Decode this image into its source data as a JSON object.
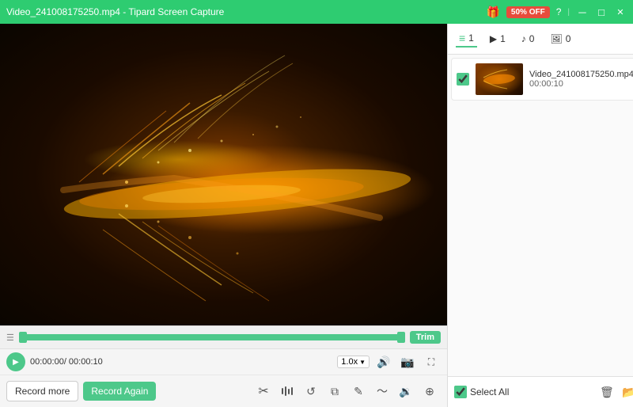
{
  "titleBar": {
    "title": "Video_241008175250.mp4  -  Tipard Screen Capture",
    "promoBadge": "50% OFF",
    "buttons": {
      "minimize": "－",
      "maximize": "□",
      "close": "✕"
    }
  },
  "tabs": [
    {
      "icon": "≡",
      "count": "1",
      "type": "list"
    },
    {
      "icon": "▶",
      "count": "1",
      "type": "video"
    },
    {
      "icon": "♪",
      "count": "0",
      "type": "audio"
    },
    {
      "icon": "🖼",
      "count": "0",
      "type": "image"
    }
  ],
  "fileItem": {
    "name": "Video_241008175250.mp4",
    "duration": "00:00:10",
    "checked": true
  },
  "trimBar": {
    "trimLabel": "Trim"
  },
  "playback": {
    "timeDisplay": "00:00:00/ 00:00:10",
    "speed": "1.0x"
  },
  "buttons": {
    "recordMore": "Record more",
    "recordAgain": "Record Again",
    "selectAll": "Select All",
    "trim": "Trim"
  }
}
